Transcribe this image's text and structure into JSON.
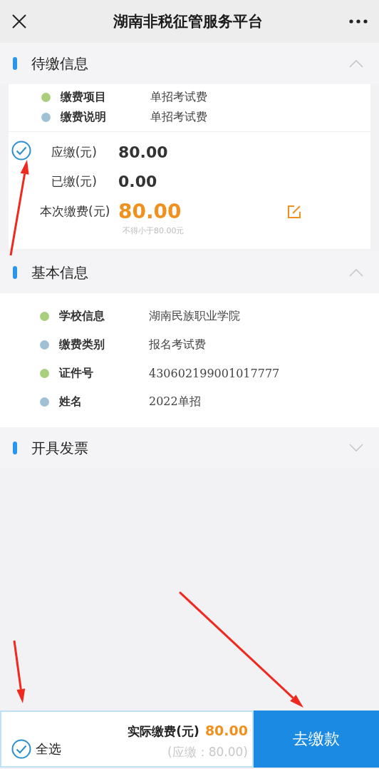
{
  "header": {
    "title": "湖南非税征管服务平台"
  },
  "sections": [
    {
      "kind": "payment",
      "title": "待缴信息",
      "expanded": true,
      "checked": true,
      "items": [
        {
          "label": "缴费项目",
          "value": "单招考试费",
          "color": "#a9cf7c"
        },
        {
          "label": "缴费说明",
          "value": "单招考试费",
          "color": "#9fc1d3"
        }
      ],
      "amounts": [
        {
          "kind": "plain",
          "label": "应缴(元)",
          "value": "80.00"
        },
        {
          "kind": "plain",
          "label": "已缴(元)",
          "value": "0.00"
        },
        {
          "kind": "editable",
          "label": "本次缴费(元)",
          "value": "80.00",
          "hint": "不得小于80.00元"
        }
      ]
    },
    {
      "kind": "info",
      "title": "基本信息",
      "expanded": true,
      "items": [
        {
          "label": "学校信息",
          "value": "湖南民族职业学院",
          "color": "#a9cf7c"
        },
        {
          "label": "缴费类别",
          "value": "报名考试费",
          "color": "#9fc1d3"
        },
        {
          "label": "证件号",
          "value": "430602199001017777",
          "color": "#a9cf7c"
        },
        {
          "label": "姓名",
          "value": "2022单招",
          "color": "#9fc1d3"
        }
      ]
    },
    {
      "kind": "info",
      "title": "开具发票",
      "expanded": false
    }
  ],
  "footer": {
    "select_all": {
      "label": "全选",
      "checked": true
    },
    "total_label": "实际缴费(元)",
    "total": "80.00",
    "due": "(应缴：80.00)",
    "pay_button": "去缴款"
  }
}
